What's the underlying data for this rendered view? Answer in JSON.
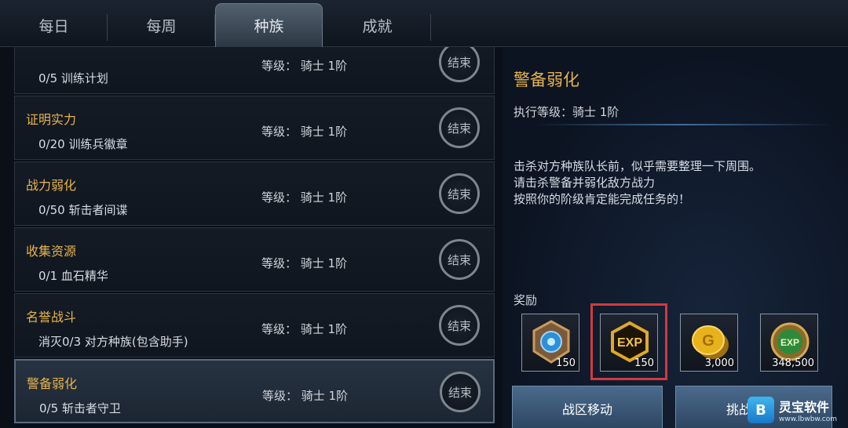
{
  "tabs": [
    {
      "label": "每日"
    },
    {
      "label": "每周"
    },
    {
      "label": "种族"
    },
    {
      "label": "成就"
    }
  ],
  "quests": [
    {
      "name": "",
      "progress": "0/5 训练计划",
      "level": "等级： 骑士 1阶",
      "button": "结束"
    },
    {
      "name": "证明实力",
      "progress": "0/20 训练兵徽章",
      "level": "等级： 骑士 1阶",
      "button": "结束"
    },
    {
      "name": "战力弱化",
      "progress": "0/50 斩击者间谍",
      "level": "等级： 骑士 1阶",
      "button": "结束"
    },
    {
      "name": "收集资源",
      "progress": "0/1 血石精华",
      "level": "等级： 骑士 1阶",
      "button": "结束"
    },
    {
      "name": "名誉战斗",
      "progress": "消灭0/3 对方种族(包含助手)",
      "level": "等级： 骑士 1阶",
      "button": "结束"
    },
    {
      "name": "警备弱化",
      "progress": "0/5 斩击者守卫",
      "level": "等级： 骑士 1阶",
      "button": "结束"
    }
  ],
  "detail": {
    "title": "警备弱化",
    "exec_level": "执行等级：骑士 1阶",
    "desc": [
      "击杀对方种族队长前，似乎需要整理一下周围。",
      "请击杀警备并弱化敌方战力",
      "按照你的阶级肯定能完成任务的！"
    ],
    "reward_label": "奖励",
    "rewards": [
      {
        "icon": "medal-icon",
        "count": "150"
      },
      {
        "icon": "exp-icon",
        "count": "150"
      },
      {
        "icon": "gold-coin-icon",
        "count": "3,000"
      },
      {
        "icon": "exp-orb-icon",
        "count": "348,500"
      }
    ],
    "buttons": {
      "move": "战区移动",
      "challenge": "挑战"
    }
  },
  "watermark": {
    "name": "灵宝软件",
    "url": "www.lbwbw.com",
    "logo": "B"
  },
  "colors": {
    "gold": "#e7b34a",
    "highlight": "#d03a3e",
    "button_blue": "#3a5a7c"
  }
}
